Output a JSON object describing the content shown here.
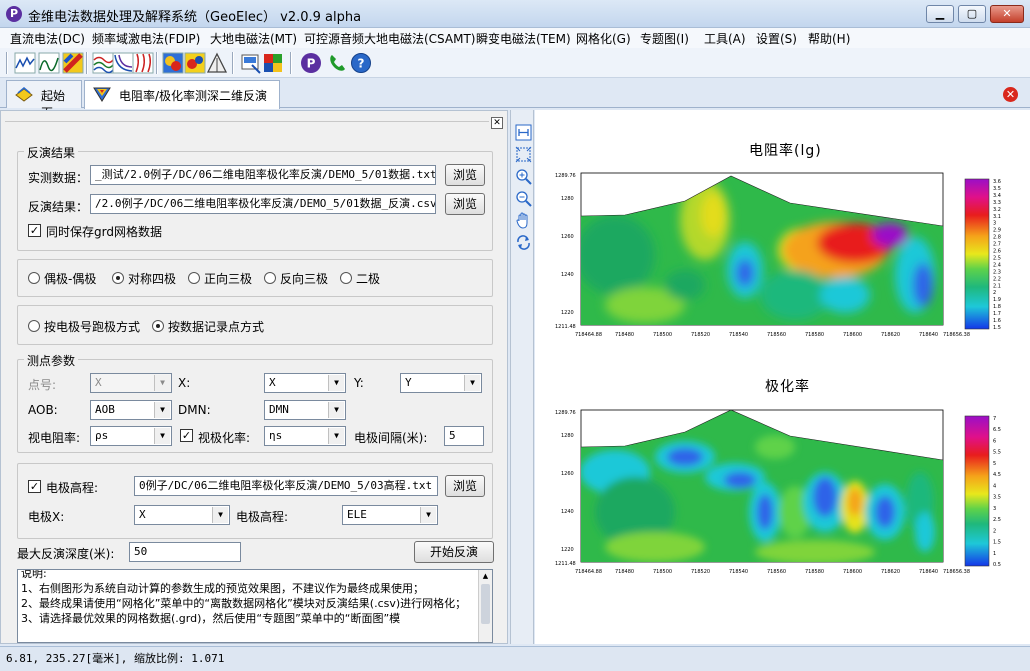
{
  "window": {
    "title": "金维电法数据处理及解释系统（GeoElec） v2.0.9 alpha"
  },
  "menu": [
    "直流电法(DC)",
    "频率域激电法(FDIP)",
    "大地电磁法(MT)",
    "可控源音频大地电磁法(CSAMT)",
    "瞬变电磁法(TEM)",
    "网格化(G)",
    "专题图(I)",
    "工具(A)",
    "设置(S)",
    "帮助(H)"
  ],
  "tabs": [
    {
      "label": "起始页",
      "icon": "home-icon"
    },
    {
      "label": "电阻率/极化率测深二维反演",
      "icon": "section-icon"
    }
  ],
  "panel": {
    "result_group": "反演结果",
    "measured_label": "实测数据：",
    "measured_value": "_测试/2.0例子/DC/06二维电阻率极化率反演/DEMO_5/01数据.txt",
    "inverted_label": "反演结果：",
    "inverted_value": "/2.0例子/DC/06二维电阻率极化率反演/DEMO_5/01数据_反演.csv",
    "browse": "浏览",
    "save_grid_label": "同时保存grd网格数据",
    "save_grid_checked": true,
    "arrays": [
      {
        "label": "偶极-偶极",
        "checked": false
      },
      {
        "label": "对称四极",
        "checked": true
      },
      {
        "label": "正向三极",
        "checked": false
      },
      {
        "label": "反向三极",
        "checked": false
      },
      {
        "label": "二极",
        "checked": false
      }
    ],
    "modes": [
      {
        "label": "按电极号跑极方式",
        "checked": false
      },
      {
        "label": "按数据记录点方式",
        "checked": true
      }
    ],
    "params_group": "测点参数",
    "point_label": "点号:",
    "point_value": "X",
    "x_label": "X:",
    "x_value": "X",
    "y_label": "Y:",
    "y_value": "Y",
    "aob_label": "AOB:",
    "aob_value": "AOB",
    "dmn_label": "DMN:",
    "dmn_value": "DMN",
    "rho_label": "视电阻率:",
    "rho_value": "ρs",
    "eta_label": "视极化率:",
    "eta_value": "ηs",
    "eta_checked": true,
    "spacing_label": "电极间隔(米):",
    "spacing_value": "5",
    "elev_label": "电极高程:",
    "elev_checked": true,
    "elev_file": "0例子/DC/06二维电阻率极化率反演/DEMO_5/03高程.txt",
    "elec_x_label": "电极X:",
    "elec_x_value": "X",
    "elec_h_label": "电极高程:",
    "elec_h_value": "ELE",
    "depth_label": "最大反演深度(米):",
    "depth_value": "50",
    "start_button": "开始反演",
    "notes": [
      "说明:",
      "1、右侧图形为系统自动计算的参数生成的预览效果图，不建议作为最终成果使用；",
      "2、最终成果请使用“网格化”菜单中的“离散数据网格化”模块对反演结果(.csv)进行网格化；",
      "3、请选择最优效果的网格数据(.grd)，然后使用“专题图”菜单中的“断面图”模"
    ]
  },
  "charts": {
    "top_title": "电阻率(lg)",
    "bottom_title": "极化率",
    "x_ticks": [
      "718464.88",
      "718480",
      "718500",
      "718520",
      "718540",
      "718560",
      "718580",
      "718600",
      "718620",
      "718640",
      "718656.38"
    ],
    "y_ticks": [
      "1211.48",
      "1220",
      "1240",
      "1260",
      "1280",
      "1289.76"
    ],
    "top_scale": [
      "3.6",
      "3.5",
      "3.4",
      "3.3",
      "3.2",
      "3.1",
      "3",
      "2.9",
      "2.8",
      "2.7",
      "2.6",
      "2.5",
      "2.4",
      "2.3",
      "2.2",
      "2.1",
      "2",
      "1.9",
      "1.8",
      "1.7",
      "1.6",
      "1.5"
    ],
    "bottom_scale": [
      "7",
      "6.5",
      "6",
      "5.5",
      "5",
      "4.5",
      "4",
      "3.5",
      "3",
      "2.5",
      "2",
      "1.5",
      "1",
      "0.5"
    ]
  },
  "status": {
    "text": "6.81, 235.27[毫米], 缩放比例: 1.071"
  }
}
